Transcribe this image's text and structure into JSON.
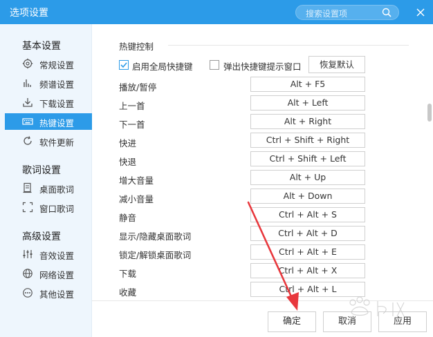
{
  "window": {
    "title": "选项设置"
  },
  "search": {
    "placeholder": "搜索设置项"
  },
  "sidebar": {
    "groups": [
      {
        "title": "基本设置",
        "items": [
          {
            "label": "常规设置",
            "icon": "gear-icon"
          },
          {
            "label": "频谱设置",
            "icon": "spectrum-icon"
          },
          {
            "label": "下载设置",
            "icon": "download-icon"
          },
          {
            "label": "热键设置",
            "icon": "keyboard-icon",
            "active": true
          },
          {
            "label": "软件更新",
            "icon": "refresh-icon"
          }
        ]
      },
      {
        "title": "歌词设置",
        "items": [
          {
            "label": "桌面歌词",
            "icon": "desktop-lyrics-icon"
          },
          {
            "label": "窗口歌词",
            "icon": "window-lyrics-icon"
          }
        ]
      },
      {
        "title": "高级设置",
        "items": [
          {
            "label": "音效设置",
            "icon": "equalizer-icon"
          },
          {
            "label": "网络设置",
            "icon": "globe-icon"
          },
          {
            "label": "其他设置",
            "icon": "more-icon"
          }
        ]
      }
    ]
  },
  "hotkeys": {
    "section_title": "热键控制",
    "enable_global_label": "启用全局快捷键",
    "enable_global_checked": true,
    "popup_tip_label": "弹出快捷键提示窗口",
    "popup_tip_checked": false,
    "restore_label": "恢复默认",
    "rows": [
      {
        "label": "播放/暂停",
        "key": "Alt + F5"
      },
      {
        "label": "上一首",
        "key": "Alt + Left"
      },
      {
        "label": "下一首",
        "key": "Alt + Right"
      },
      {
        "label": "快进",
        "key": "Ctrl + Shift + Right"
      },
      {
        "label": "快退",
        "key": "Ctrl + Shift + Left"
      },
      {
        "label": "增大音量",
        "key": "Alt + Up"
      },
      {
        "label": "减小音量",
        "key": "Alt + Down"
      },
      {
        "label": "静音",
        "key": "Ctrl + Alt + S"
      },
      {
        "label": "显示/隐藏桌面歌词",
        "key": "Ctrl + Alt + D"
      },
      {
        "label": "锁定/解锁桌面歌词",
        "key": "Ctrl + Alt + E"
      },
      {
        "label": "下载",
        "key": "Ctrl + Alt + X"
      },
      {
        "label": "收藏",
        "key": "Ctrl + Alt + L"
      }
    ]
  },
  "footer": {
    "ok_label": "确定",
    "cancel_label": "取消",
    "apply_label": "应用"
  },
  "colors": {
    "accent": "#2c9be8",
    "annotation_arrow": "#e8383d"
  }
}
